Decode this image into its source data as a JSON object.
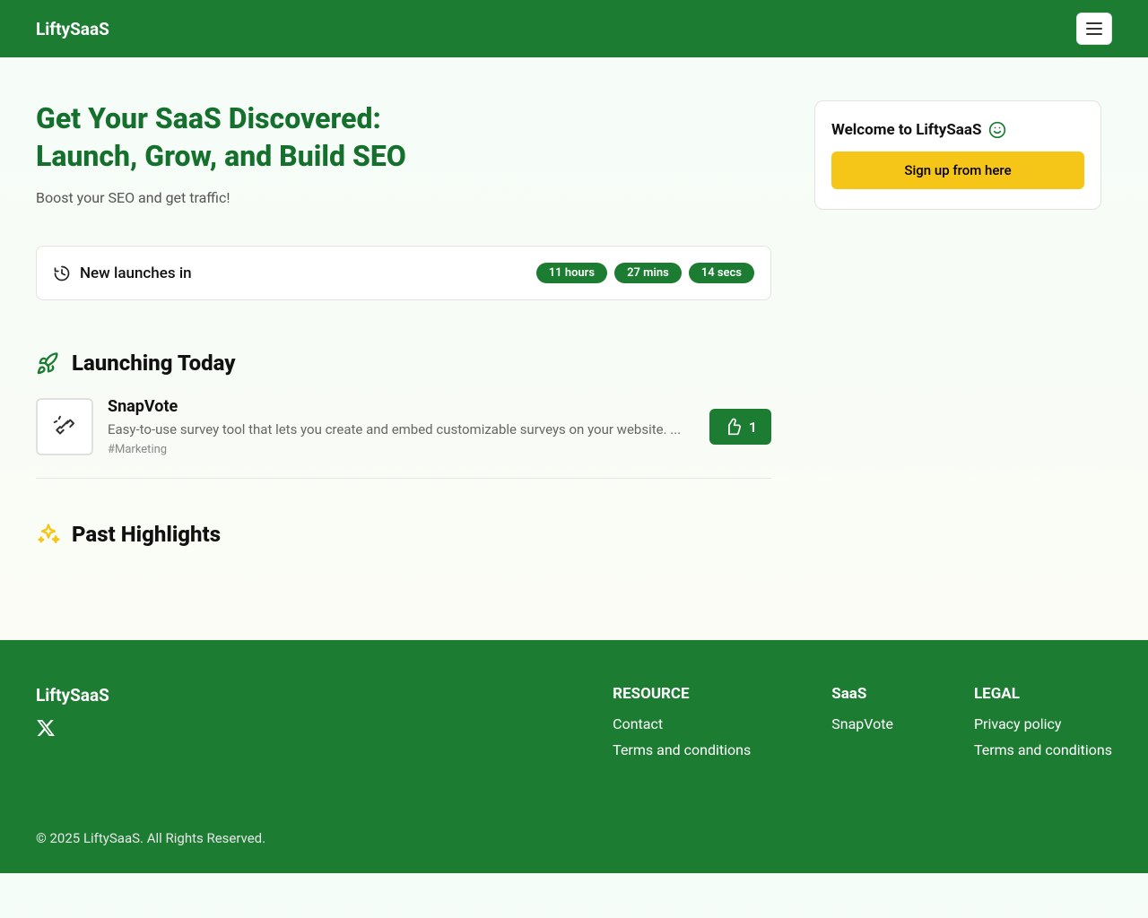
{
  "header": {
    "logo": "LiftySaaS"
  },
  "hero": {
    "headline_line1": "Get Your SaaS Discovered:",
    "headline_line2": "Launch, Grow, and Build SEO",
    "subhead": "Boost your SEO and get traffic!"
  },
  "countdown": {
    "label": "New launches in",
    "chips": [
      "11 hours",
      "27 mins",
      "14 secs"
    ]
  },
  "launching_today": {
    "title": "Launching Today",
    "item": {
      "name": "SnapVote",
      "description": "Easy-to-use survey tool that lets you create and embed customizable surveys on your website. ...",
      "tag": "#Marketing",
      "upvotes": "1"
    }
  },
  "past_highlights": {
    "title": "Past Highlights"
  },
  "sidebar": {
    "welcome": "Welcome to LiftySaaS",
    "signup_label": "Sign up from here"
  },
  "footer": {
    "logo": "LiftySaaS",
    "cols": [
      {
        "heading": "RESOURCE",
        "links": [
          "Contact",
          "Terms and conditions"
        ]
      },
      {
        "heading": "SaaS",
        "links": [
          "SnapVote"
        ]
      },
      {
        "heading": "LEGAL",
        "links": [
          "Privacy policy",
          "Terms and conditions"
        ]
      }
    ],
    "copyright": "© 2025 LiftySaaS. All Rights Reserved."
  }
}
